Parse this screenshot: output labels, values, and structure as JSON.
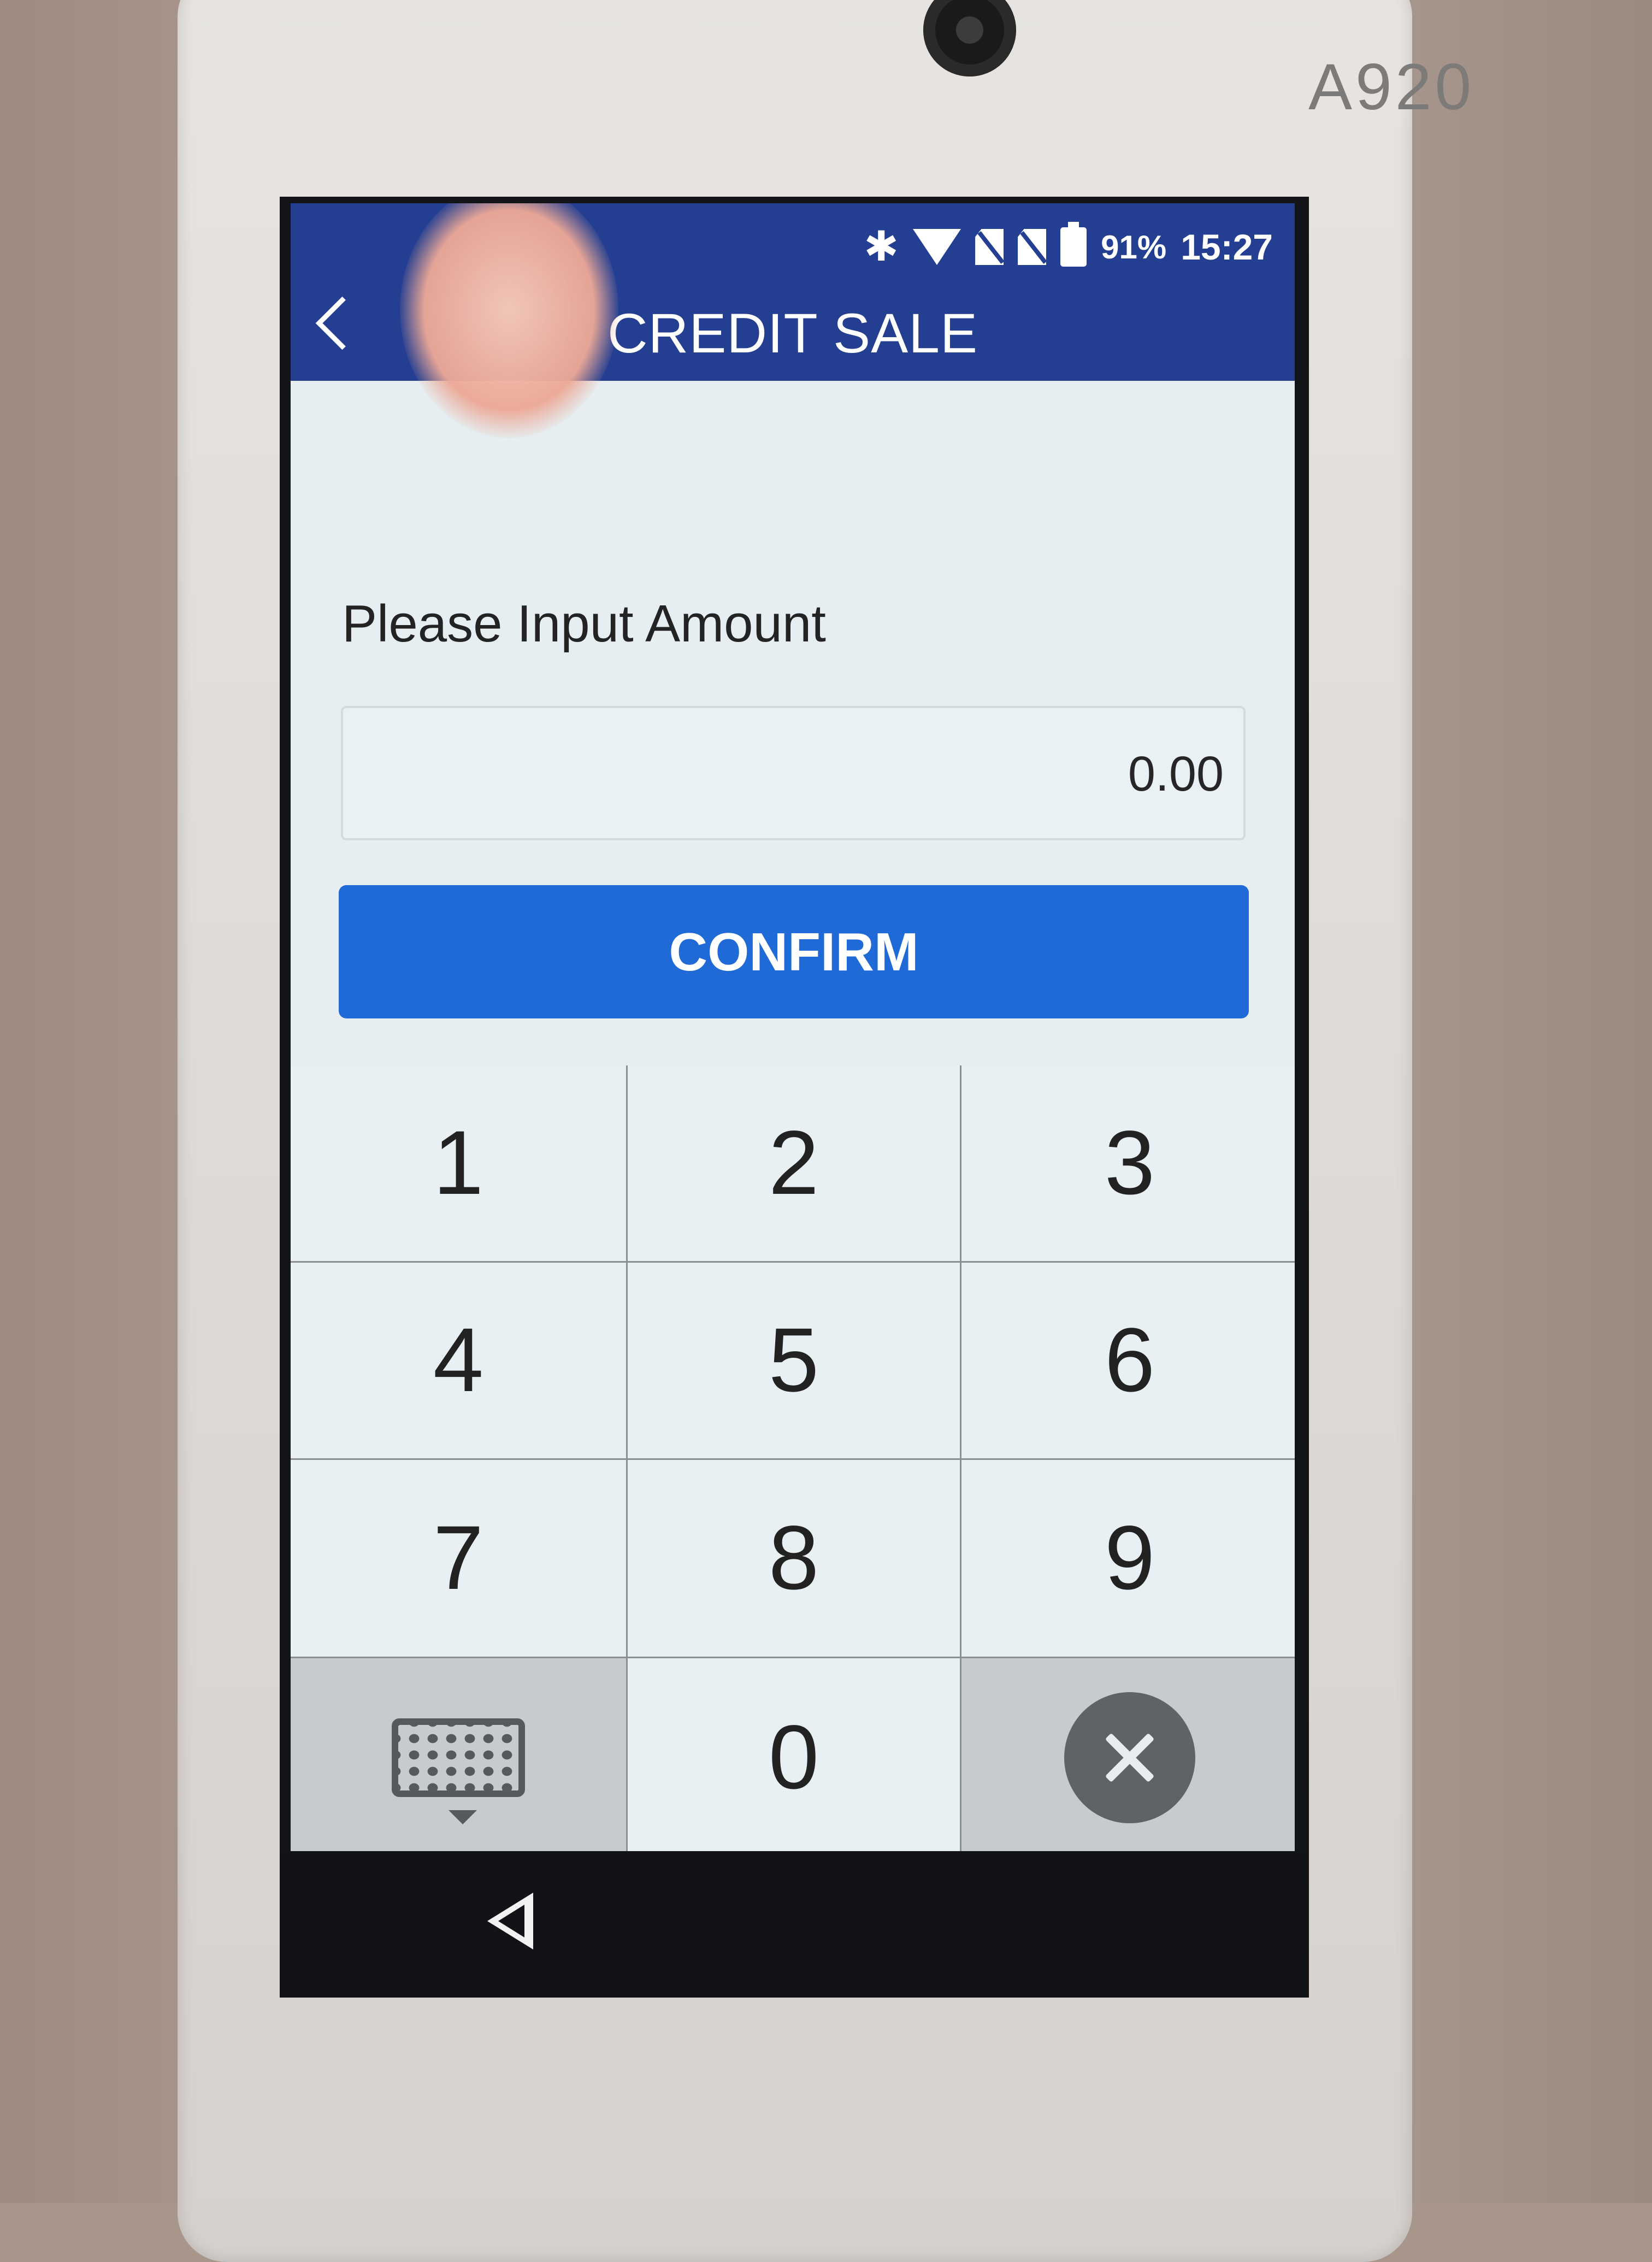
{
  "device": {
    "model": "A920"
  },
  "status_bar": {
    "battery": "91%",
    "time": "15:27"
  },
  "app_bar": {
    "title": "CREDIT SALE"
  },
  "form": {
    "prompt": "Please Input Amount",
    "amount_value": "0.00",
    "confirm_label": "CONFIRM"
  },
  "keypad": {
    "keys": [
      "1",
      "2",
      "3",
      "4",
      "5",
      "6",
      "7",
      "8",
      "9",
      "0"
    ],
    "left_key_icon": "keyboard-icon",
    "right_key_icon": "clear-icon"
  },
  "colors": {
    "app_bar": "#243f91",
    "confirm": "#1f6ad6",
    "keypad_bg": "#e8f0f3"
  }
}
